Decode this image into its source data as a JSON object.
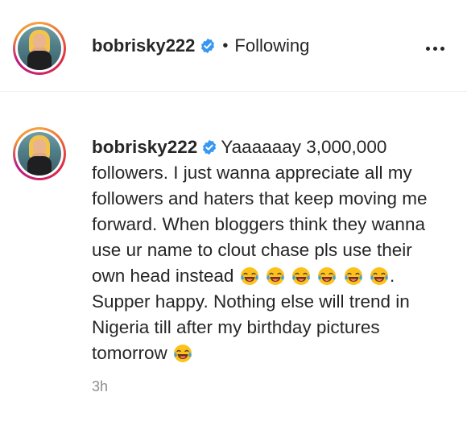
{
  "header": {
    "username": "bobrisky222",
    "separator": "•",
    "follow_status": "Following",
    "avatar_icon": "profile-photo",
    "verified_icon": "verified-badge-icon",
    "more_icon": "more-options-icon"
  },
  "comment": {
    "username": "bobrisky222",
    "text_part1": "Yaaaaaay 3,000,000 followers. I just wanna appreciate all my followers and haters that keep moving me forward. When bloggers think they wanna use ur name to clout chase pls use their own head instead",
    "text_part2": ". Supper happy. Nothing else will trend in Nigeria till after my birthday pictures tomorrow",
    "emoji_name": "face-with-tears-of-joy",
    "timestamp": "3h"
  },
  "colors": {
    "text": "#262626",
    "muted": "#8e8e8e",
    "verified": "#3897f0",
    "divider": "#efefef"
  }
}
